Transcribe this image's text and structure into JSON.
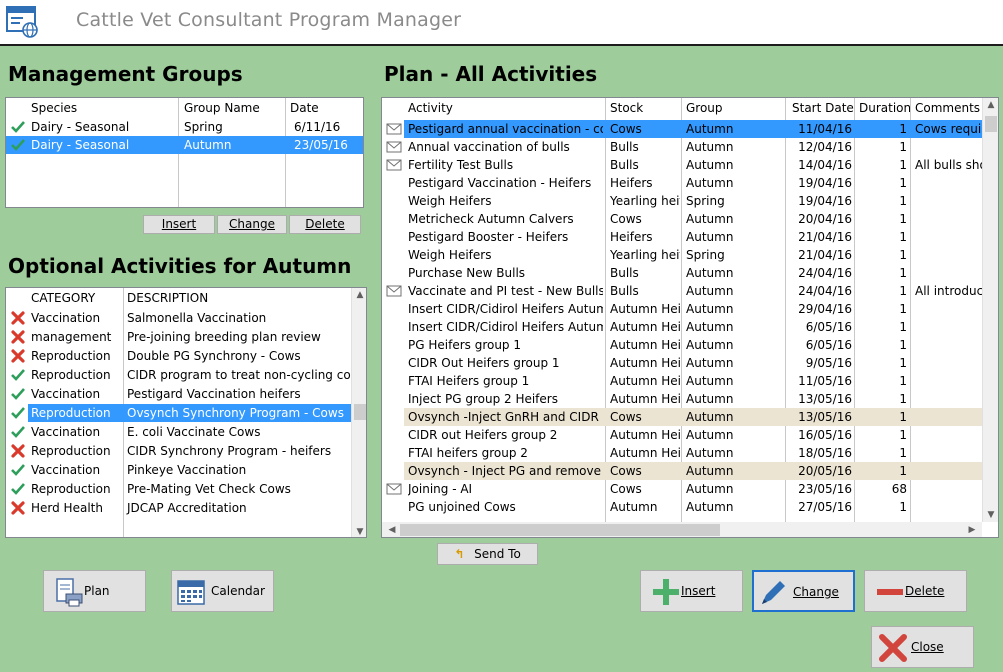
{
  "app": {
    "title": "Cattle Vet Consultant Program Manager"
  },
  "management_groups": {
    "heading": "Management Groups",
    "columns": [
      "Species",
      "Group Name",
      "Date"
    ],
    "rows": [
      {
        "species": "Dairy - Seasonal",
        "group": "Spring",
        "date": "6/11/16",
        "status": "check",
        "selected": false
      },
      {
        "species": "Dairy - Seasonal",
        "group": "Autumn",
        "date": "23/05/16",
        "status": "check",
        "selected": true
      }
    ],
    "buttons": {
      "insert": "Insert",
      "change": "Change",
      "delete": "Delete"
    }
  },
  "optional_activities": {
    "heading": "Optional Activities for Autumn",
    "columns": [
      "CATEGORY",
      "DESCRIPTION"
    ],
    "rows": [
      {
        "category": "Vaccination",
        "description": "Salmonella Vaccination",
        "status": "cross"
      },
      {
        "category": "management",
        "description": "Pre-joining breeding plan review",
        "status": "cross"
      },
      {
        "category": "Reproduction",
        "description": "Double PG Synchrony - Cows",
        "status": "cross"
      },
      {
        "category": "Reproduction",
        "description": "CIDR program to treat non-cycling cows",
        "status": "check"
      },
      {
        "category": "Vaccination",
        "description": "Pestigard Vaccination heifers",
        "status": "check"
      },
      {
        "category": "Reproduction",
        "description": "Ovsynch Synchrony Program - Cows",
        "status": "check",
        "selected": true
      },
      {
        "category": "Vaccination",
        "description": "E. coli Vaccinate Cows",
        "status": "check"
      },
      {
        "category": "Reproduction",
        "description": "CIDR Synchrony Program - heifers",
        "status": "cross"
      },
      {
        "category": "Vaccination",
        "description": "Pinkeye Vaccination",
        "status": "check"
      },
      {
        "category": "Reproduction",
        "description": "Pre-Mating Vet Check Cows",
        "status": "check"
      },
      {
        "category": "Herd Health",
        "description": "JDCAP Accreditation",
        "status": "cross"
      }
    ]
  },
  "plan": {
    "heading": "Plan - All Activities",
    "columns": [
      "Activity",
      "Stock",
      "Group",
      "Start Date",
      "Duration",
      "Comments"
    ],
    "rows": [
      {
        "mail": true,
        "activity": "Pestigard annual vaccination - cows",
        "stock": "Cows",
        "group": "Autumn",
        "start": "11/04/16",
        "duration": "1",
        "comments": "Cows require",
        "hl": "sel"
      },
      {
        "mail": true,
        "activity": "Annual vaccination of bulls",
        "stock": "Bulls",
        "group": "Autumn",
        "start": "12/04/16",
        "duration": "1",
        "comments": "",
        "hl": ""
      },
      {
        "mail": true,
        "activity": "Fertility Test  Bulls",
        "stock": "Bulls",
        "group": "Autumn",
        "start": "14/04/16",
        "duration": "1",
        "comments": "All bulls shou",
        "hl": ""
      },
      {
        "mail": false,
        "activity": "Pestigard Vaccination - Heifers",
        "stock": "Heifers",
        "group": "Autumn",
        "start": "19/04/16",
        "duration": "1",
        "comments": "",
        "hl": ""
      },
      {
        "mail": false,
        "activity": "Weigh Heifers",
        "stock": "Yearling heife",
        "group": "Spring",
        "start": "19/04/16",
        "duration": "1",
        "comments": "",
        "hl": ""
      },
      {
        "mail": false,
        "activity": "Metricheck Autumn Calvers",
        "stock": "Cows",
        "group": "Autumn",
        "start": "20/04/16",
        "duration": "1",
        "comments": "",
        "hl": ""
      },
      {
        "mail": false,
        "activity": "Pestigard Booster - Heifers",
        "stock": "Heifers",
        "group": "Autumn",
        "start": "21/04/16",
        "duration": "1",
        "comments": "",
        "hl": ""
      },
      {
        "mail": false,
        "activity": "Weigh Heifers",
        "stock": "Yearling heife",
        "group": "Spring",
        "start": "21/04/16",
        "duration": "1",
        "comments": "",
        "hl": ""
      },
      {
        "mail": false,
        "activity": "Purchase New Bulls",
        "stock": "Bulls",
        "group": "Autumn",
        "start": "24/04/16",
        "duration": "1",
        "comments": "",
        "hl": ""
      },
      {
        "mail": true,
        "activity": "Vaccinate and PI test  - New Bulls",
        "stock": "Bulls",
        "group": "Autumn",
        "start": "24/04/16",
        "duration": "1",
        "comments": "All introduce",
        "hl": ""
      },
      {
        "mail": false,
        "activity": "Insert CIDR/Cidirol Heifers Autumn g",
        "stock": "Autumn Heife",
        "group": "Autumn",
        "start": "29/04/16",
        "duration": "1",
        "comments": "",
        "hl": ""
      },
      {
        "mail": false,
        "activity": "Insert CIDR/Cidirol Heifers Autumn g",
        "stock": "Autumn Heife",
        "group": "Autumn",
        "start": "6/05/16",
        "duration": "1",
        "comments": "",
        "hl": ""
      },
      {
        "mail": false,
        "activity": "PG Heifers group 1",
        "stock": "Autumn Heife",
        "group": "Autumn",
        "start": "6/05/16",
        "duration": "1",
        "comments": "",
        "hl": ""
      },
      {
        "mail": false,
        "activity": "CIDR Out Heifers group 1",
        "stock": "Autumn Heife",
        "group": "Autumn",
        "start": "9/05/16",
        "duration": "1",
        "comments": "",
        "hl": ""
      },
      {
        "mail": false,
        "activity": "FTAI Heifers group 1",
        "stock": "Autumn Heife",
        "group": "Autumn",
        "start": "11/05/16",
        "duration": "1",
        "comments": "",
        "hl": ""
      },
      {
        "mail": false,
        "activity": "Inject PG group 2 Heifers",
        "stock": "Autumn Heife",
        "group": "Autumn",
        "start": "13/05/16",
        "duration": "1",
        "comments": "",
        "hl": ""
      },
      {
        "mail": false,
        "activity": "Ovsynch -Inject GnRH and CIDR",
        "stock": "Cows",
        "group": "Autumn",
        "start": "13/05/16",
        "duration": "1",
        "comments": "",
        "hl": "beige"
      },
      {
        "mail": false,
        "activity": "CIDR out Heifers group 2",
        "stock": "Autumn Heife",
        "group": "Autumn",
        "start": "16/05/16",
        "duration": "1",
        "comments": "",
        "hl": ""
      },
      {
        "mail": false,
        "activity": "FTAI heifers group 2",
        "stock": "Autumn Heife",
        "group": "Autumn",
        "start": "18/05/16",
        "duration": "1",
        "comments": "",
        "hl": ""
      },
      {
        "mail": false,
        "activity": "Ovsynch - Inject PG and remove CIDR",
        "stock": "Cows",
        "group": "Autumn",
        "start": "20/05/16",
        "duration": "1",
        "comments": "",
        "hl": "beige"
      },
      {
        "mail": true,
        "activity": "Joining - AI",
        "stock": "Cows",
        "group": "Autumn",
        "start": "23/05/16",
        "duration": "68",
        "comments": "",
        "hl": ""
      },
      {
        "mail": false,
        "activity": "PG unjoined Cows",
        "stock": "Autumn",
        "group": "Autumn",
        "start": "27/05/16",
        "duration": "1",
        "comments": "",
        "hl": ""
      }
    ]
  },
  "buttons": {
    "send_to": "Send To",
    "plan": "Plan",
    "calendar": "Calendar",
    "insert": "Insert",
    "change": "Change",
    "delete": "Delete",
    "close": "Close"
  },
  "colors": {
    "background": "#9ecc9b",
    "selection": "#3399ff",
    "highlight_row": "#ece4d2",
    "check": "#2e9e5b",
    "cross": "#d93a2b"
  }
}
